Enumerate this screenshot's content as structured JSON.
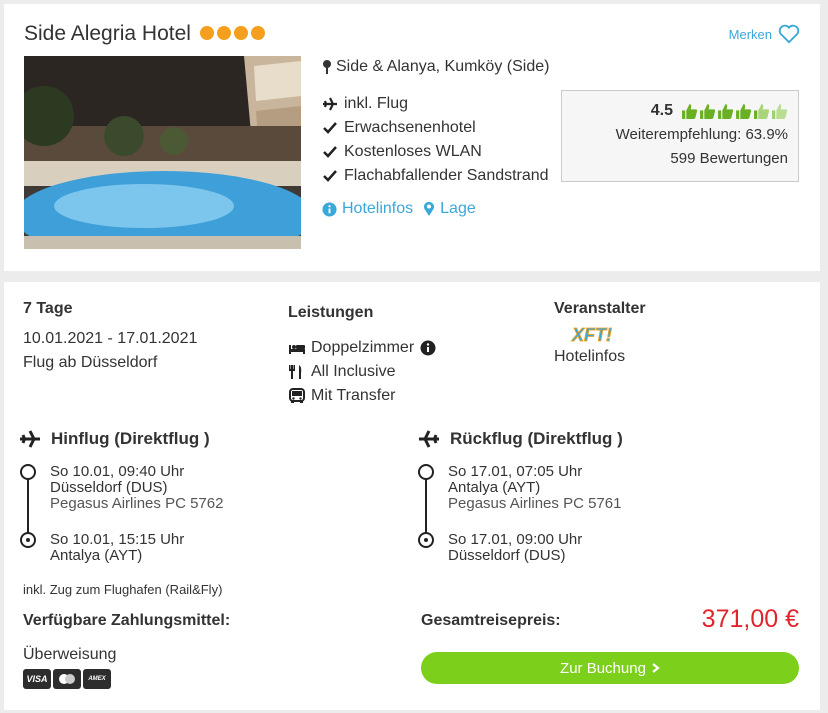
{
  "hotel": {
    "name": "Side Alegria Hotel",
    "stars": 4,
    "merken_label": "Merken",
    "location": "Side & Alanya, Kumköy (Side)",
    "features": [
      "inkl. Flug",
      "Erwachsenenhotel",
      "Kostenloses WLAN",
      "Flachabfallender Sandstrand"
    ],
    "links": {
      "hotelinfos": "Hotelinfos",
      "lage": "Lage"
    },
    "rating": {
      "score": "4.5",
      "thumbs_filled": 4.5,
      "recommendation": "Weiterempfehlung: 63.9%",
      "reviews": "599 Bewertungen"
    }
  },
  "offer": {
    "duration": "7 Tage",
    "dates": "10.01.2021 - 17.01.2021",
    "departure": "Flug ab Düsseldorf",
    "leistungen_title": "Leistungen",
    "leistungen": [
      "Doppelzimmer",
      "All Inclusive",
      "Mit Transfer"
    ],
    "veranstalter_title": "Veranstalter",
    "veranstalter_logo": "XFT!",
    "veranstalter_link": "Hotelinfos"
  },
  "hinflug": {
    "title": "Hinflug (Direktflug )",
    "dep_time": "So 10.01, 09:40 Uhr",
    "dep_airport": "Düsseldorf (DUS)",
    "airline": "Pegasus Airlines PC 5762",
    "arr_time": "So 10.01, 15:15 Uhr",
    "arr_airport": "Antalya (AYT)"
  },
  "rueckflug": {
    "title": "Rückflug (Direktflug )",
    "dep_time": "So 17.01, 07:05 Uhr",
    "dep_airport": "Antalya (AYT)",
    "airline": "Pegasus Airlines PC 5761",
    "arr_time": "So 17.01, 09:00 Uhr",
    "arr_airport": "Düsseldorf (DUS)"
  },
  "rail_note": "inkl. Zug zum Flughafen (Rail&Fly)",
  "payment": {
    "title": "Verfügbare Zahlungsmittel:",
    "method": "Überweisung",
    "cards": [
      "VISA",
      "MC",
      "AMEX"
    ]
  },
  "price": {
    "label": "Gesamtreisepreis:",
    "value": "371,00 €",
    "button": "Zur Buchung"
  },
  "colors": {
    "accent": "#3aa8d8",
    "star": "#f4a01e",
    "price": "#e0262c",
    "button": "#7ccf1a",
    "thumb": "#6ab023"
  }
}
